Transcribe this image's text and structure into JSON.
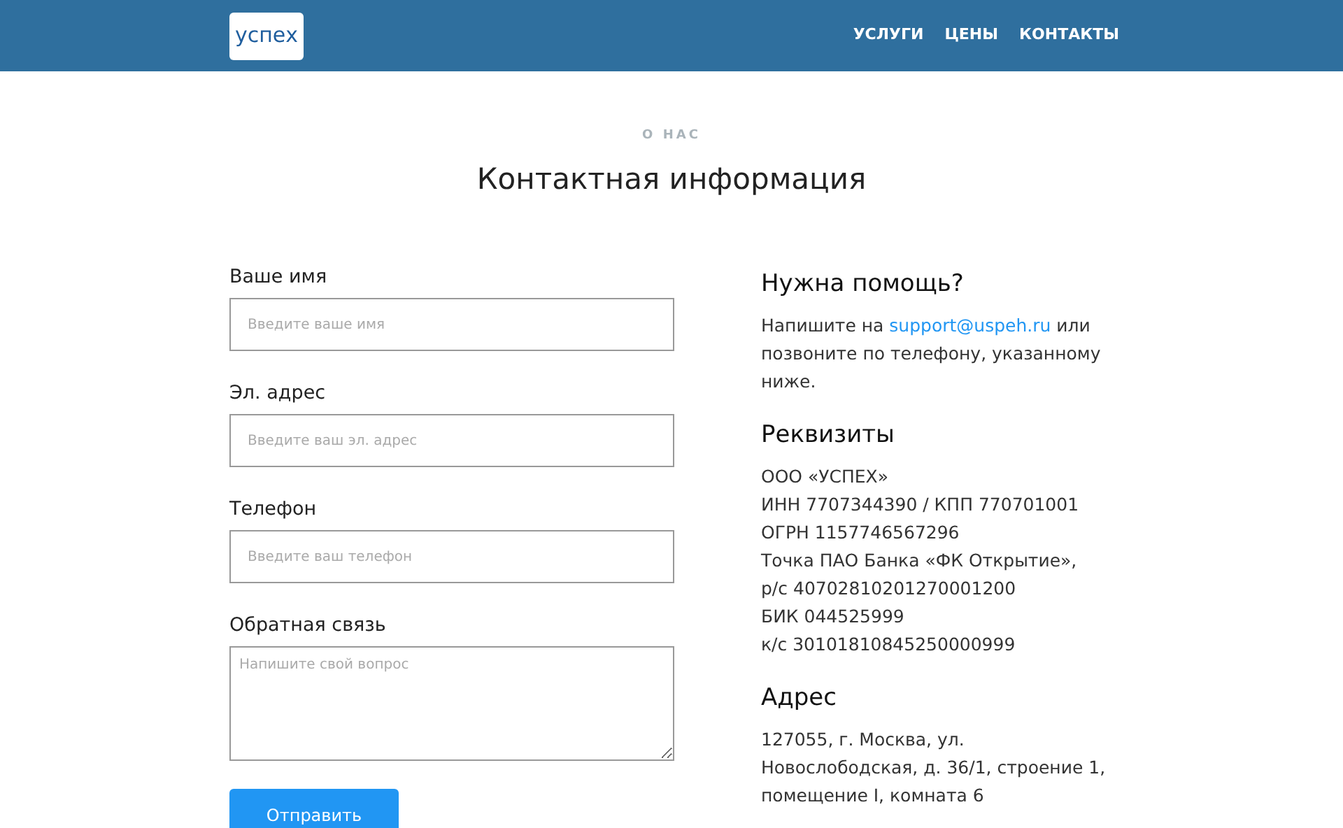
{
  "header": {
    "logo": "успех",
    "nav": [
      "УСЛУГИ",
      "ЦЕНЫ",
      "КОНТАКТЫ"
    ]
  },
  "eyebrow": "О НАС",
  "title": "Контактная информация",
  "form": {
    "fields": [
      {
        "kind": "input",
        "label": "Ваше имя",
        "placeholder": "Введите ваше имя"
      },
      {
        "kind": "input",
        "label": "Эл. адрес",
        "placeholder": "Введите ваш эл. адрес"
      },
      {
        "kind": "input",
        "label": "Телефон",
        "placeholder": "Введите ваш телефон"
      },
      {
        "kind": "textarea",
        "label": "Обратная связь",
        "placeholder": "Напишите свой вопрос"
      }
    ],
    "submit": "Отправить"
  },
  "help": {
    "heading": "Нужна помощь?",
    "before": "Напишите на",
    "link": "support@uspeh.ru",
    "after": "или позвоните по телефону, указанному ниже."
  },
  "requisites": {
    "heading": "Реквизиты",
    "lines": [
      "ООО «УСПЕХ»",
      "ИНН 7707344390 / КПП 770701001",
      "ОГРН 1157746567296",
      "Точка ПАО Банка «ФК Открытие»,",
      "р/с 40702810201270001200",
      "БИК 044525999",
      "к/с 30101810845250000999"
    ]
  },
  "address": {
    "heading": "Адрес",
    "text": "127055, г. Москва, ул. Новослободская, д. 36/1, строение 1, помещение I, комната 6"
  }
}
